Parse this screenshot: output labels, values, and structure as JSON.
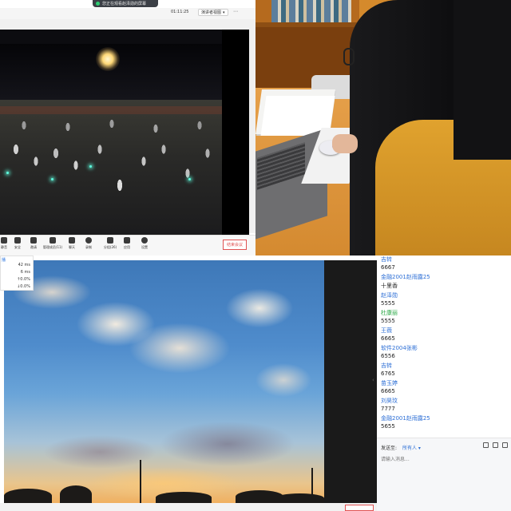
{
  "top_left": {
    "pill_text": "您正在观看赵泽勋的屏幕",
    "timer": "01:11:25",
    "view_label": "演讲者视图",
    "view_caret": "▾",
    "more": "⋯",
    "toolbar": [
      {
        "label": "静音",
        "icon": "microphone-icon"
      },
      {
        "label": "安全",
        "icon": "shield-icon"
      },
      {
        "label": "邀请",
        "icon": "invite-icon"
      },
      {
        "label": "管理成员(11)",
        "icon": "members-icon"
      },
      {
        "label": "聊天",
        "icon": "chat-icon"
      },
      {
        "label": "录制",
        "icon": "record-icon"
      },
      {
        "label": "分组(26)",
        "icon": "breakout-icon"
      },
      {
        "label": "应用",
        "icon": "apps-icon"
      },
      {
        "label": "设置",
        "icon": "gear-icon"
      }
    ],
    "end_meeting": "结束会议"
  },
  "bottom_left": {
    "stats_corner": "播",
    "stats": [
      "42 ms",
      "6 ms",
      "↑0.0%",
      "↓0.0%"
    ],
    "chevron": "‹"
  },
  "chat": {
    "messages": [
      {
        "sender": "吉转",
        "text": "6667",
        "sender_color": "blue"
      },
      {
        "sender": "金融2001赵雨露25",
        "text": "十里香",
        "sender_color": "blue"
      },
      {
        "sender": "赵泽勋",
        "text": "5555",
        "sender_color": "blue"
      },
      {
        "sender": "杜康丽",
        "text": "5555",
        "sender_color": "green"
      },
      {
        "sender": "王薇",
        "text": "6665",
        "sender_color": "blue"
      },
      {
        "sender": "软件2004张彬",
        "text": "6556",
        "sender_color": "blue"
      },
      {
        "sender": "吉转",
        "text": "6765",
        "sender_color": "blue"
      },
      {
        "sender": "苗玉婷",
        "text": "6665",
        "sender_color": "blue"
      },
      {
        "sender": "刘昊玟",
        "text": "7777",
        "sender_color": "blue"
      },
      {
        "sender": "金融2001赵雨露25",
        "text": "5655",
        "sender_color": "blue"
      }
    ],
    "send_to_label": "发送至:",
    "send_to_value": "所有人 ▾",
    "input_placeholder": "请输入消息..."
  },
  "colors": {
    "accent_blue": "#2d6fd6",
    "accent_green": "#2aa845",
    "end_red": "#e05252"
  }
}
